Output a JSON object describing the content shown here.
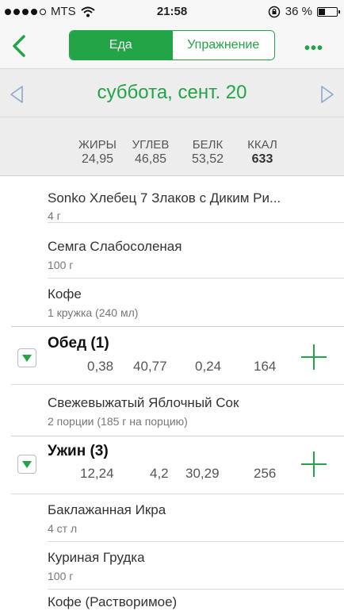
{
  "status": {
    "carrier": "MTS",
    "time": "21:58",
    "battery": "36 %",
    "battery_level": 0.36
  },
  "nav": {
    "tab_food": "Еда",
    "tab_exercise": "Упражнение",
    "more": "•••"
  },
  "date": {
    "title": "суббота, сент. 20"
  },
  "totals": {
    "fat_label": "ЖИРЫ",
    "fat": "24,95",
    "carbs_label": "УГЛЕВ",
    "carbs": "46,85",
    "protein_label": "БЕЛК",
    "protein": "53,52",
    "kcal_label": "ККАЛ",
    "kcal": "633"
  },
  "breakfast_items": [
    {
      "name": "Sonko Хлебец 7 Злаков с Диким Ри...",
      "serving": "4 г"
    },
    {
      "name": "Семга Слабосоленая",
      "serving": "100 г"
    },
    {
      "name": "Кофе",
      "serving": "1 кружка (240 мл)"
    }
  ],
  "lunch": {
    "title": "Обед (1)",
    "fat": "0,38",
    "carbs": "40,77",
    "protein": "0,24",
    "kcal": "164",
    "items": [
      {
        "name": "Свежевыжатый Яблочный Сок",
        "serving": "2 порции (185 г на порцию)"
      }
    ]
  },
  "dinner": {
    "title": "Ужин (3)",
    "fat": "12,24",
    "carbs": "4,2",
    "protein": "30,29",
    "kcal": "256",
    "items": [
      {
        "name": "Баклажанная Икра",
        "serving": "4 ст л"
      },
      {
        "name": "Куриная Грудка",
        "serving": "100 г"
      },
      {
        "name": "Кофе (Растворимое)",
        "serving": ""
      }
    ]
  },
  "colors": {
    "accent": "#22a447"
  }
}
